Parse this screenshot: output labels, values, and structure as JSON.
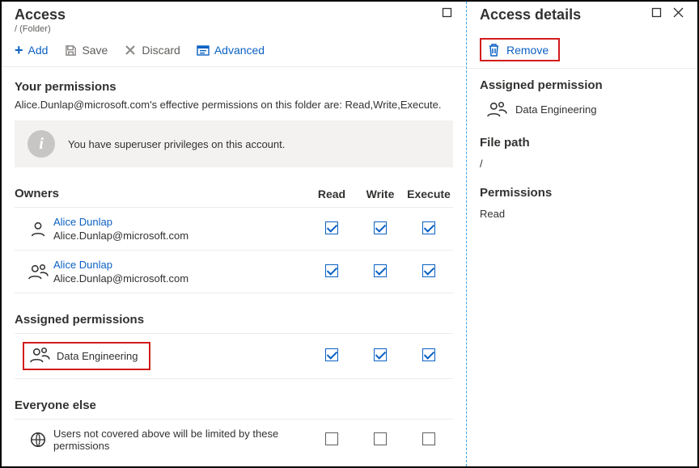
{
  "left": {
    "title": "Access",
    "subtitle": "/ (Folder)",
    "toolbar": {
      "add": "Add",
      "save": "Save",
      "discard": "Discard",
      "advanced": "Advanced"
    },
    "yourPermissions": {
      "heading": "Your permissions",
      "description": "Alice.Dunlap@microsoft.com's effective permissions on this folder are: Read,Write,Execute.",
      "banner": "You have superuser privileges on this account."
    },
    "owners": {
      "heading": "Owners",
      "cols": {
        "read": "Read",
        "write": "Write",
        "execute": "Execute"
      },
      "rows": [
        {
          "name": "Alice Dunlap",
          "email": "Alice.Dunlap@microsoft.com",
          "read": true,
          "write": true,
          "execute": true,
          "iconType": "single"
        },
        {
          "name": "Alice Dunlap",
          "email": "Alice.Dunlap@microsoft.com",
          "read": true,
          "write": true,
          "execute": true,
          "iconType": "group"
        }
      ]
    },
    "assigned": {
      "heading": "Assigned permissions",
      "rows": [
        {
          "name": "Data Engineering",
          "read": true,
          "write": true,
          "execute": true
        }
      ]
    },
    "everyone": {
      "heading": "Everyone else",
      "text": "Users not covered above will be limited by these permissions",
      "read": false,
      "write": false,
      "execute": false
    }
  },
  "right": {
    "title": "Access details",
    "remove": "Remove",
    "assigned": {
      "heading": "Assigned permission",
      "name": "Data Engineering"
    },
    "filePath": {
      "heading": "File path",
      "value": "/"
    },
    "permissions": {
      "heading": "Permissions",
      "value": "Read"
    }
  }
}
